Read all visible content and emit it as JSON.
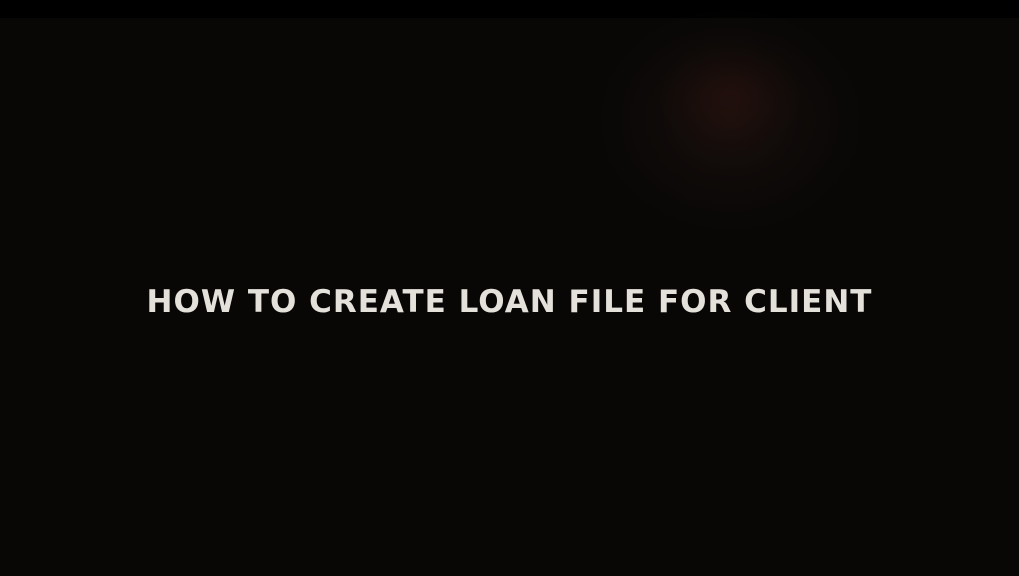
{
  "video": {
    "title_card_text": "How to Create Loan File for Client"
  },
  "colors": {
    "background": "#080706",
    "top_band": "#000000",
    "title_text": "#e4e1db"
  }
}
